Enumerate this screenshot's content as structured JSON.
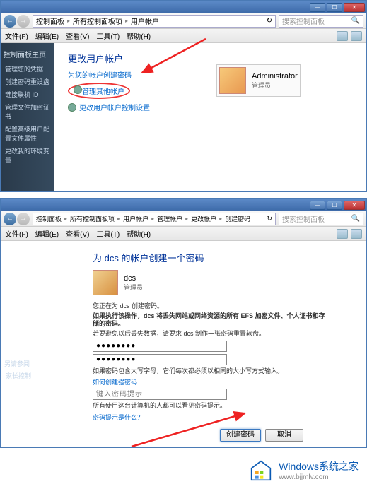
{
  "window1": {
    "nav": {
      "back": "←",
      "forward": "→"
    },
    "breadcrumbs": [
      "控制面板",
      "所有控制面板项",
      "用户帐户"
    ],
    "search_placeholder": "搜索控制面板",
    "menus": [
      "文件(F)",
      "编辑(E)",
      "查看(V)",
      "工具(T)",
      "帮助(H)"
    ],
    "sidebar": {
      "title": "控制面板主页",
      "items": [
        "管理您的凭据",
        "创建密码重设盘",
        "链接联机 ID",
        "管理文件加密证书",
        "配置高级用户配置文件属性",
        "更改我的环境变量"
      ]
    },
    "page_title": "更改用户帐户",
    "subtitle": "为您的帐户创建密码",
    "task1": "管理其他帐户",
    "task2": "更改用户帐户控制设置",
    "admin_name": "Administrator",
    "admin_role": "管理员",
    "seealso_title": "另请参阅",
    "seealso_item": "家长控制"
  },
  "window2": {
    "breadcrumbs": [
      "控制面板",
      "所有控制面板项",
      "用户帐户",
      "管理帐户",
      "更改帐户",
      "创建密码"
    ],
    "search_placeholder": "搜索控制面板",
    "menus": [
      "文件(F)",
      "编辑(E)",
      "查看(V)",
      "工具(T)",
      "帮助(H)"
    ],
    "page_title": "为 dcs 的帐户创建一个密码",
    "user_name": "dcs",
    "user_role": "管理员",
    "warn1": "您正在为 dcs 创建密码。",
    "warn2": "如果执行该操作，dcs 将丢失网站或网络资源的所有 EFS 加密文件、个人证书和存储的密码。",
    "warn3": "若要避免以后丢失数据，请要求 dcs 制作一张密码重置软盘。",
    "pwd_value": "●●●●●●●●",
    "hint_label": "如果密码包含大写字母，它们每次都必须以相同的大小写方式输入。",
    "help_link": "如何创建强密码",
    "hint_placeholder": "键入密码提示",
    "hint_desc": "所有使用这台计算机的人都可以看见密码提示。",
    "help_link2": "密码提示是什么？",
    "btn_create": "创建密码",
    "btn_cancel": "取消"
  },
  "footer": {
    "brand_main": "Windows系统之家",
    "brand_sub": "www.bjjmlv.com"
  }
}
